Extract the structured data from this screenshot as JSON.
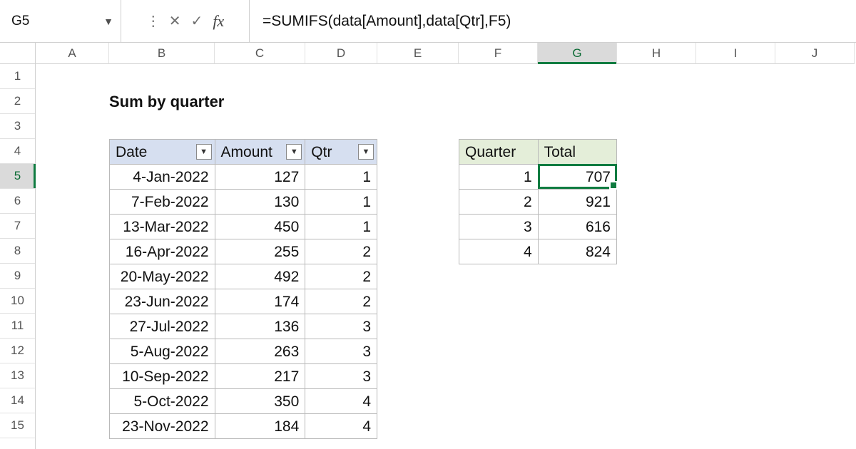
{
  "name_box": "G5",
  "formula": "=SUMIFS(data[Amount],data[Qtr],F5)",
  "columns": [
    "A",
    "B",
    "C",
    "D",
    "E",
    "F",
    "G",
    "H",
    "I",
    "J"
  ],
  "active_col": "G",
  "rows": [
    "1",
    "2",
    "3",
    "4",
    "5",
    "6",
    "7",
    "8",
    "9",
    "10",
    "11",
    "12",
    "13",
    "14",
    "15"
  ],
  "active_row": "5",
  "title": "Sum by quarter",
  "tableL": {
    "headers": [
      "Date",
      "Amount",
      "Qtr"
    ],
    "rows": [
      [
        "4-Jan-2022",
        "127",
        "1"
      ],
      [
        "7-Feb-2022",
        "130",
        "1"
      ],
      [
        "13-Mar-2022",
        "450",
        "1"
      ],
      [
        "16-Apr-2022",
        "255",
        "2"
      ],
      [
        "20-May-2022",
        "492",
        "2"
      ],
      [
        "23-Jun-2022",
        "174",
        "2"
      ],
      [
        "27-Jul-2022",
        "136",
        "3"
      ],
      [
        "5-Aug-2022",
        "263",
        "3"
      ],
      [
        "10-Sep-2022",
        "217",
        "3"
      ],
      [
        "5-Oct-2022",
        "350",
        "4"
      ],
      [
        "23-Nov-2022",
        "184",
        "4"
      ]
    ]
  },
  "tableR": {
    "headers": [
      "Quarter",
      "Total"
    ],
    "rows": [
      [
        "1",
        "707"
      ],
      [
        "2",
        "921"
      ],
      [
        "3",
        "616"
      ],
      [
        "4",
        "824"
      ]
    ]
  }
}
